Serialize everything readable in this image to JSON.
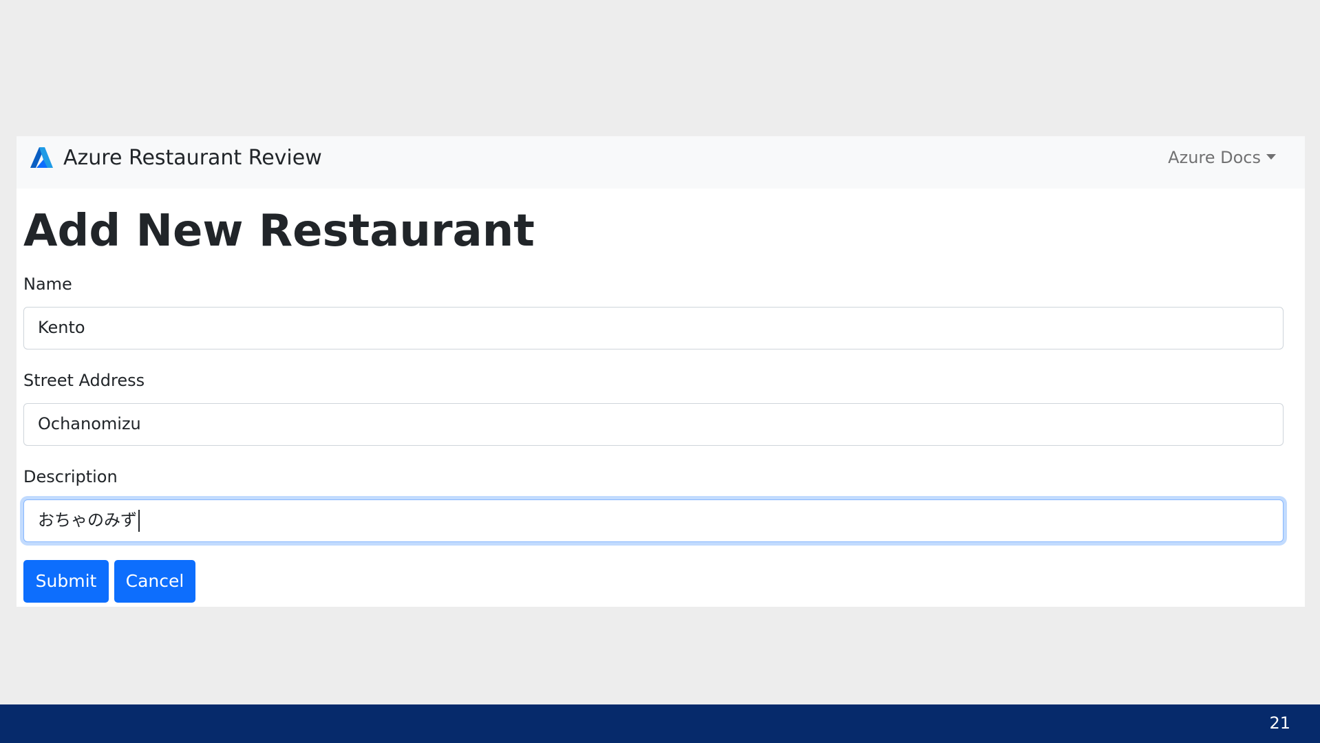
{
  "navbar": {
    "brand_title": "Azure Restaurant Review",
    "docs_menu_label": "Azure Docs"
  },
  "page": {
    "title": "Add New Restaurant"
  },
  "form": {
    "name_label": "Name",
    "name_value": "Kento",
    "address_label": "Street Address",
    "address_value": "Ochanomizu",
    "description_label": "Description",
    "description_value": "おちゃのみず"
  },
  "buttons": {
    "submit_label": "Submit",
    "cancel_label": "Cancel"
  },
  "footer": {
    "page_number": "21"
  },
  "theme": {
    "primary": "#0d6efd",
    "navbar_bg": "#f8f9fa",
    "footer_bg": "#062a6b",
    "focus_ring": "#86b7fe"
  },
  "icons": {
    "brand": "azure-logo-icon",
    "dropdown": "caret-down-icon"
  }
}
